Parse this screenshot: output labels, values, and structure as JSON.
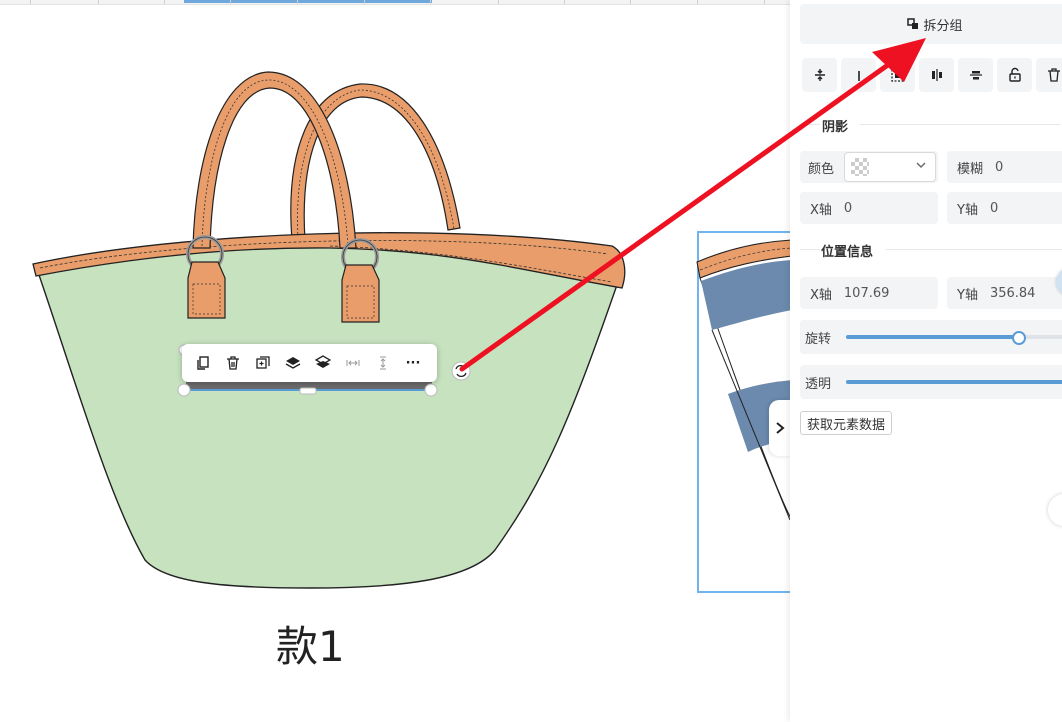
{
  "canvas": {
    "design_label": "款1"
  },
  "object_toolbar": {
    "tools": [
      {
        "name": "copy-icon"
      },
      {
        "name": "trash-icon"
      },
      {
        "name": "duplicate-icon"
      },
      {
        "name": "layer-up-icon"
      },
      {
        "name": "layer-down-icon"
      },
      {
        "name": "horizontal-spacing-icon"
      },
      {
        "name": "vertical-spacing-icon"
      },
      {
        "name": "more-icon"
      }
    ],
    "more_label": "···"
  },
  "panel": {
    "ungroup_label": "拆分组",
    "icon_row": [
      "align-vertical-center-icon",
      "align-top-icon",
      "flip-icon",
      "align-horizontal-center-icon",
      "align-middle-icon",
      "unlock-icon",
      "trash-icon"
    ],
    "shadow": {
      "title": "阴影",
      "color_label": "颜色",
      "blur_label": "模糊",
      "blur_value": "0",
      "x_label": "X轴",
      "x_value": "0",
      "y_label": "Y轴",
      "y_value": "0"
    },
    "position": {
      "title": "位置信息",
      "x_label": "X轴",
      "x_value": "107.69",
      "y_label": "Y轴",
      "y_value": "356.84"
    },
    "rotation": {
      "label": "旋转",
      "value_fraction": 0.75
    },
    "opacity": {
      "label": "透明",
      "value_fraction": 1.0
    },
    "fetch_button": "获取元素数据"
  },
  "colors": {
    "bag_body": "#c6e2bf",
    "strap": "#e89d6a",
    "accent": "#5b9bd5",
    "annotation_arrow": "#ee1122"
  }
}
